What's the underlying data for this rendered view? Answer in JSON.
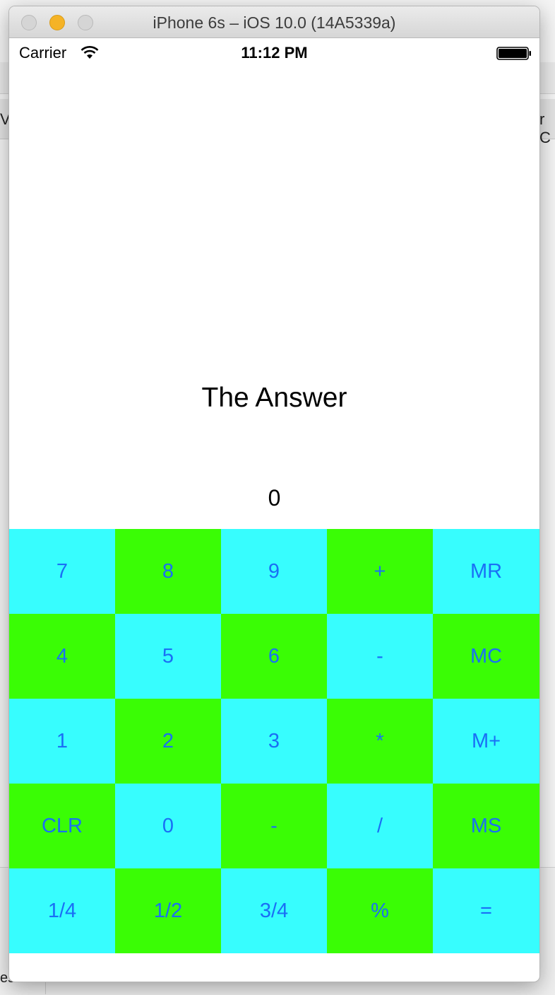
{
  "simulator": {
    "window_title": "iPhone 6s – iOS 10.0 (14A5339a)"
  },
  "background_app": {
    "tab_left_fragment": "Vi",
    "tab_right_fragment": "r C",
    "bottom_left_fragment": "es"
  },
  "status_bar": {
    "carrier": "Carrier",
    "time": "11:12 PM",
    "wifi_icon": "wifi-icon",
    "battery_icon": "battery-icon"
  },
  "calculator": {
    "title": "The Answer",
    "display": "0",
    "colors": {
      "cyan": "#37fdfe",
      "green": "#3afd05",
      "key_text": "#1a6ff5"
    },
    "keys": [
      {
        "label": "7",
        "name": "key-7",
        "color": "cyan"
      },
      {
        "label": "8",
        "name": "key-8",
        "color": "green"
      },
      {
        "label": "9",
        "name": "key-9",
        "color": "cyan"
      },
      {
        "label": "+",
        "name": "key-plus",
        "color": "green"
      },
      {
        "label": "MR",
        "name": "key-memory-recall",
        "color": "cyan"
      },
      {
        "label": "4",
        "name": "key-4",
        "color": "green"
      },
      {
        "label": "5",
        "name": "key-5",
        "color": "cyan"
      },
      {
        "label": "6",
        "name": "key-6",
        "color": "green"
      },
      {
        "label": "-",
        "name": "key-minus",
        "color": "cyan"
      },
      {
        "label": "MC",
        "name": "key-memory-clear",
        "color": "green"
      },
      {
        "label": "1",
        "name": "key-1",
        "color": "cyan"
      },
      {
        "label": "2",
        "name": "key-2",
        "color": "green"
      },
      {
        "label": "3",
        "name": "key-3",
        "color": "cyan"
      },
      {
        "label": "*",
        "name": "key-multiply",
        "color": "green"
      },
      {
        "label": "M+",
        "name": "key-memory-add",
        "color": "cyan"
      },
      {
        "label": "CLR",
        "name": "key-clear",
        "color": "green"
      },
      {
        "label": "0",
        "name": "key-0",
        "color": "cyan"
      },
      {
        "label": "-",
        "name": "key-negate",
        "color": "green"
      },
      {
        "label": "/",
        "name": "key-divide",
        "color": "cyan"
      },
      {
        "label": "MS",
        "name": "key-memory-store",
        "color": "green"
      },
      {
        "label": "1/4",
        "name": "key-quarter",
        "color": "cyan"
      },
      {
        "label": "1/2",
        "name": "key-half",
        "color": "green"
      },
      {
        "label": "3/4",
        "name": "key-three-quarters",
        "color": "cyan"
      },
      {
        "label": "%",
        "name": "key-percent",
        "color": "green"
      },
      {
        "label": "=",
        "name": "key-equals",
        "color": "cyan"
      }
    ]
  }
}
